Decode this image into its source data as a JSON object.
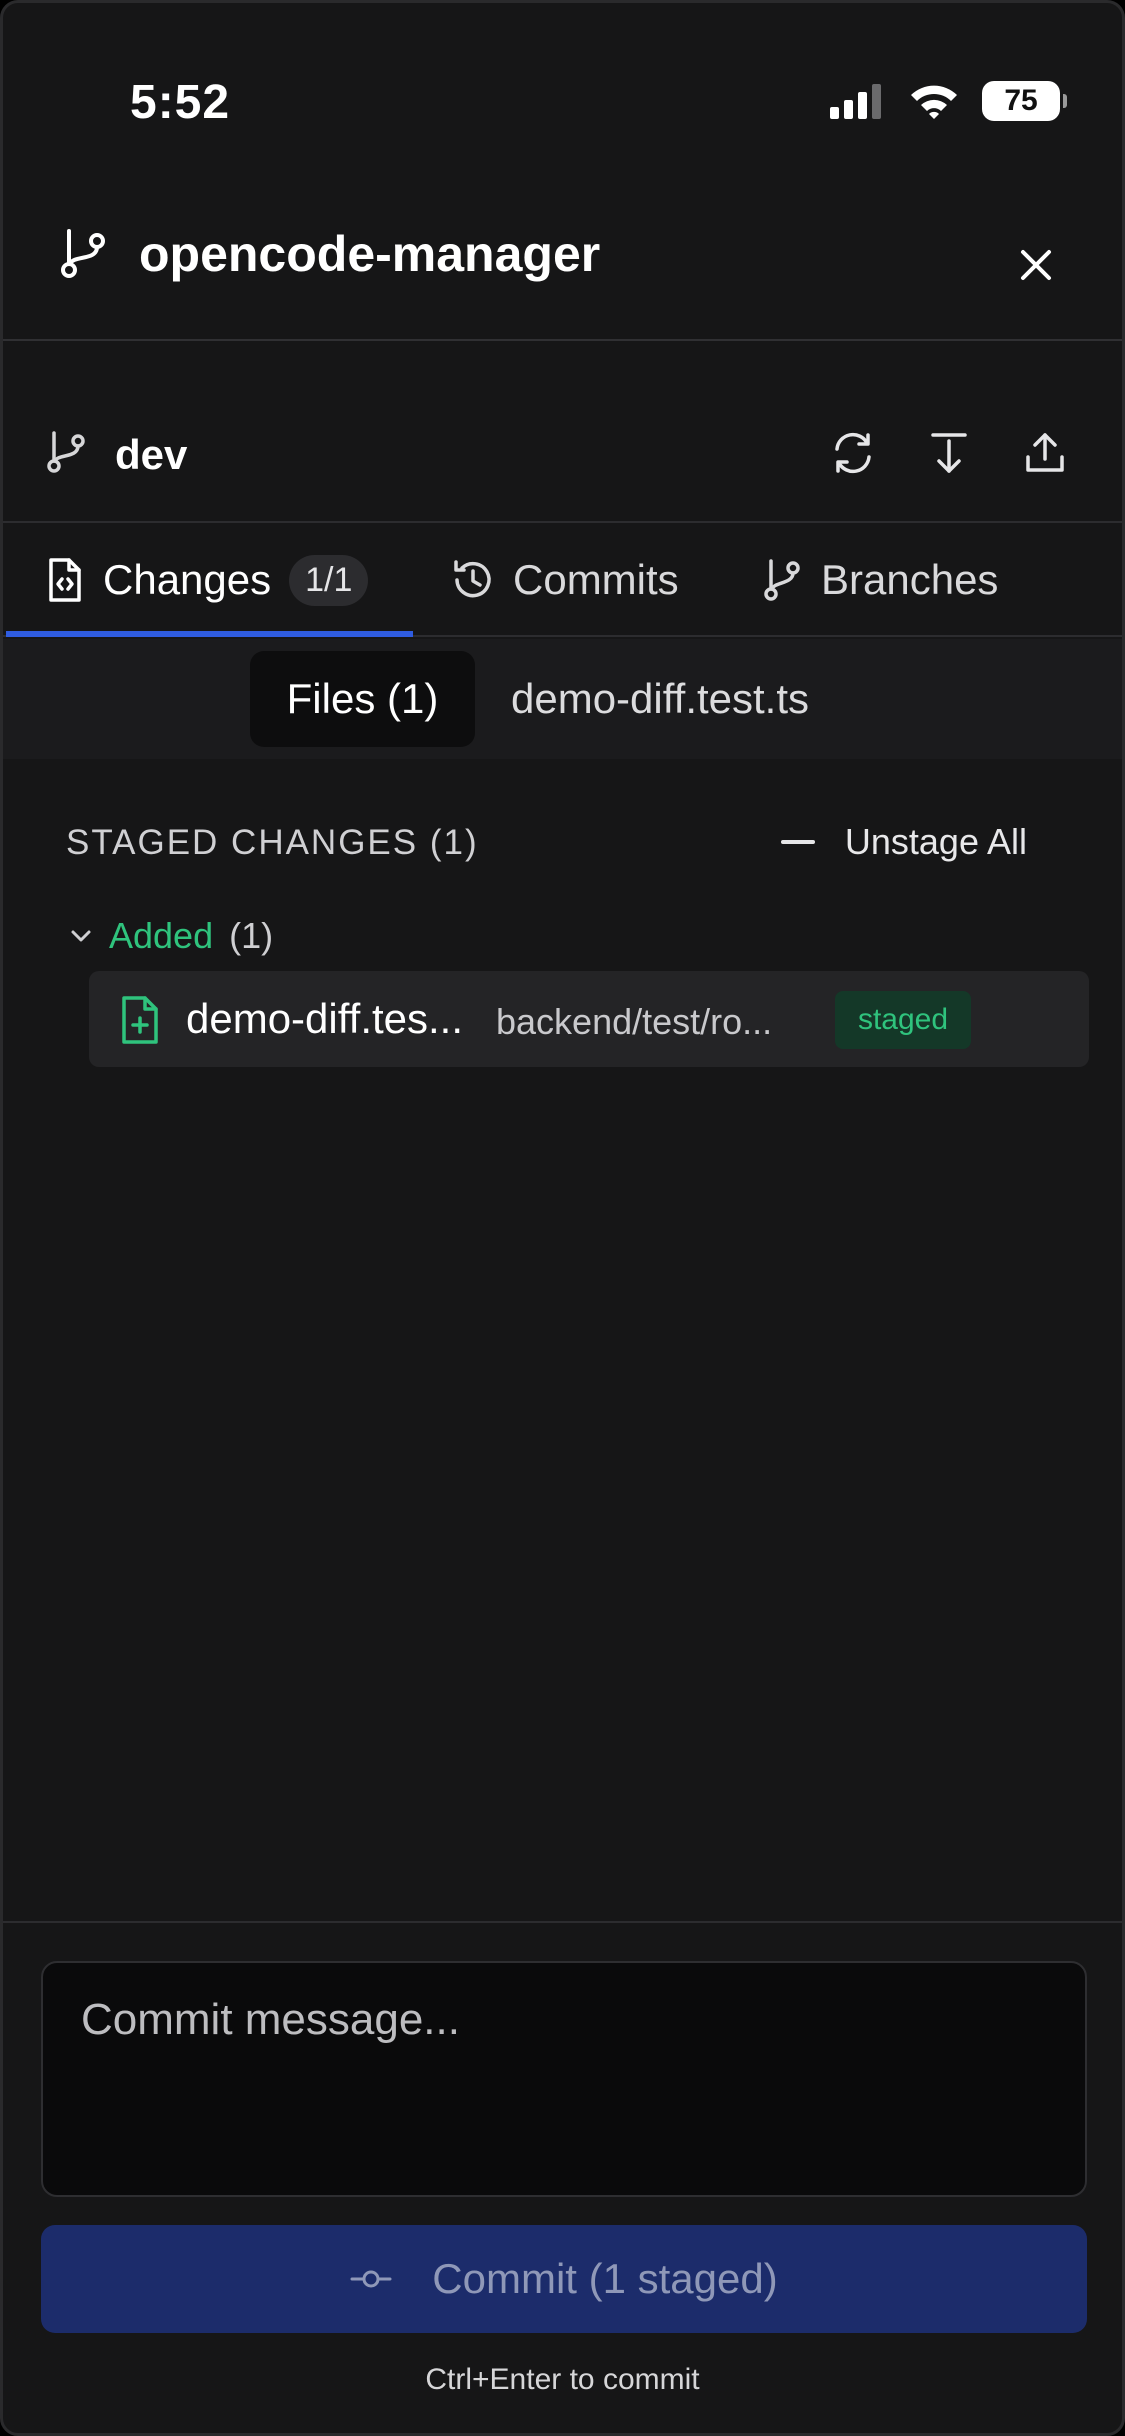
{
  "status_bar": {
    "time": "5:52",
    "battery": "75"
  },
  "header": {
    "title": "opencode-manager"
  },
  "branch": {
    "name": "dev"
  },
  "tabs": [
    {
      "label": "Changes",
      "badge": "1/1"
    },
    {
      "label": "Commits"
    },
    {
      "label": "Branches"
    }
  ],
  "subtabs": {
    "files": "Files (1)",
    "file": "demo-diff.test.ts"
  },
  "staged": {
    "title": "STAGED CHANGES (1)",
    "unstage_all": "Unstage All",
    "group_label": "Added",
    "group_count": "(1)",
    "file": {
      "name": "demo-diff.tes...",
      "path": "backend/test/ro...",
      "badge": "staged"
    }
  },
  "commit": {
    "placeholder": "Commit message...",
    "button_label": "Commit (1 staged)",
    "hint": "Ctrl+Enter to commit"
  },
  "colors": {
    "accent": "#2f5ce0",
    "added": "#2fc37d",
    "commit_button": "#1c2c6b"
  }
}
